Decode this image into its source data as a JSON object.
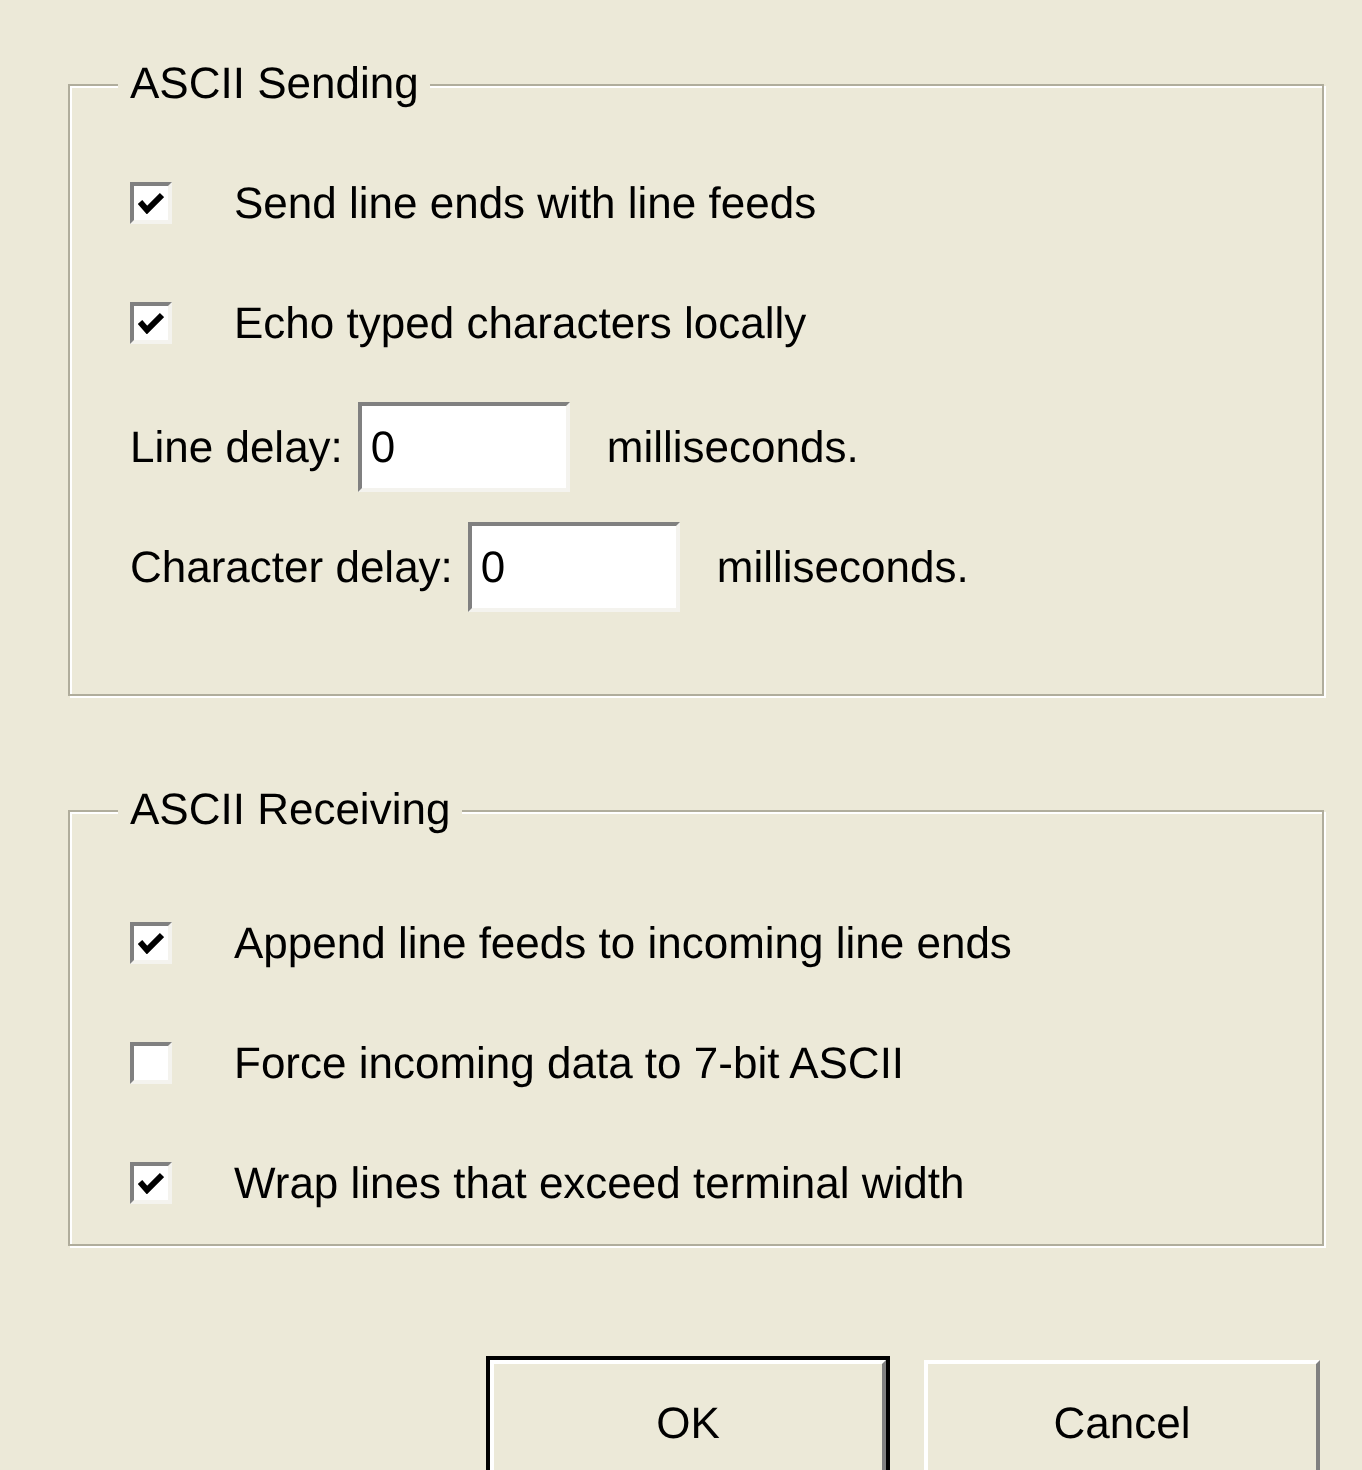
{
  "sending": {
    "title": "ASCII Sending",
    "checkboxes": [
      {
        "label": "Send line ends with line feeds",
        "checked": true
      },
      {
        "label": "Echo typed characters locally",
        "checked": true
      }
    ],
    "delays": [
      {
        "label": "Line delay:",
        "value": "0",
        "unit": "milliseconds."
      },
      {
        "label": "Character delay:",
        "value": "0",
        "unit": "milliseconds."
      }
    ]
  },
  "receiving": {
    "title": "ASCII Receiving",
    "checkboxes": [
      {
        "label": "Append line feeds to incoming line ends",
        "checked": true
      },
      {
        "label": "Force incoming data to 7-bit ASCII",
        "checked": false
      },
      {
        "label": "Wrap lines that exceed terminal width",
        "checked": true
      }
    ]
  },
  "buttons": [
    {
      "label": "OK",
      "default": true
    },
    {
      "label": "Cancel",
      "default": false
    }
  ]
}
